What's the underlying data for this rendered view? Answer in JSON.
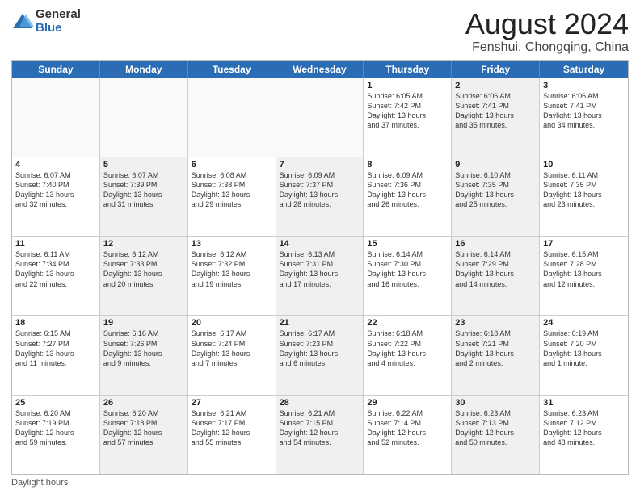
{
  "logo": {
    "general": "General",
    "blue": "Blue"
  },
  "title": "August 2024",
  "subtitle": "Fenshui, Chongqing, China",
  "days_of_week": [
    "Sunday",
    "Monday",
    "Tuesday",
    "Wednesday",
    "Thursday",
    "Friday",
    "Saturday"
  ],
  "weeks": [
    [
      {
        "day": "",
        "info": "",
        "empty": true
      },
      {
        "day": "",
        "info": "",
        "empty": true
      },
      {
        "day": "",
        "info": "",
        "empty": true
      },
      {
        "day": "",
        "info": "",
        "empty": true
      },
      {
        "day": "1",
        "info": "Sunrise: 6:05 AM\nSunset: 7:42 PM\nDaylight: 13 hours\nand 37 minutes."
      },
      {
        "day": "2",
        "info": "Sunrise: 6:06 AM\nSunset: 7:41 PM\nDaylight: 13 hours\nand 35 minutes.",
        "shaded": true
      },
      {
        "day": "3",
        "info": "Sunrise: 6:06 AM\nSunset: 7:41 PM\nDaylight: 13 hours\nand 34 minutes."
      }
    ],
    [
      {
        "day": "4",
        "info": "Sunrise: 6:07 AM\nSunset: 7:40 PM\nDaylight: 13 hours\nand 32 minutes."
      },
      {
        "day": "5",
        "info": "Sunrise: 6:07 AM\nSunset: 7:39 PM\nDaylight: 13 hours\nand 31 minutes.",
        "shaded": true
      },
      {
        "day": "6",
        "info": "Sunrise: 6:08 AM\nSunset: 7:38 PM\nDaylight: 13 hours\nand 29 minutes."
      },
      {
        "day": "7",
        "info": "Sunrise: 6:09 AM\nSunset: 7:37 PM\nDaylight: 13 hours\nand 28 minutes.",
        "shaded": true
      },
      {
        "day": "8",
        "info": "Sunrise: 6:09 AM\nSunset: 7:36 PM\nDaylight: 13 hours\nand 26 minutes."
      },
      {
        "day": "9",
        "info": "Sunrise: 6:10 AM\nSunset: 7:35 PM\nDaylight: 13 hours\nand 25 minutes.",
        "shaded": true
      },
      {
        "day": "10",
        "info": "Sunrise: 6:11 AM\nSunset: 7:35 PM\nDaylight: 13 hours\nand 23 minutes."
      }
    ],
    [
      {
        "day": "11",
        "info": "Sunrise: 6:11 AM\nSunset: 7:34 PM\nDaylight: 13 hours\nand 22 minutes."
      },
      {
        "day": "12",
        "info": "Sunrise: 6:12 AM\nSunset: 7:33 PM\nDaylight: 13 hours\nand 20 minutes.",
        "shaded": true
      },
      {
        "day": "13",
        "info": "Sunrise: 6:12 AM\nSunset: 7:32 PM\nDaylight: 13 hours\nand 19 minutes."
      },
      {
        "day": "14",
        "info": "Sunrise: 6:13 AM\nSunset: 7:31 PM\nDaylight: 13 hours\nand 17 minutes.",
        "shaded": true
      },
      {
        "day": "15",
        "info": "Sunrise: 6:14 AM\nSunset: 7:30 PM\nDaylight: 13 hours\nand 16 minutes."
      },
      {
        "day": "16",
        "info": "Sunrise: 6:14 AM\nSunset: 7:29 PM\nDaylight: 13 hours\nand 14 minutes.",
        "shaded": true
      },
      {
        "day": "17",
        "info": "Sunrise: 6:15 AM\nSunset: 7:28 PM\nDaylight: 13 hours\nand 12 minutes."
      }
    ],
    [
      {
        "day": "18",
        "info": "Sunrise: 6:15 AM\nSunset: 7:27 PM\nDaylight: 13 hours\nand 11 minutes."
      },
      {
        "day": "19",
        "info": "Sunrise: 6:16 AM\nSunset: 7:26 PM\nDaylight: 13 hours\nand 9 minutes.",
        "shaded": true
      },
      {
        "day": "20",
        "info": "Sunrise: 6:17 AM\nSunset: 7:24 PM\nDaylight: 13 hours\nand 7 minutes."
      },
      {
        "day": "21",
        "info": "Sunrise: 6:17 AM\nSunset: 7:23 PM\nDaylight: 13 hours\nand 6 minutes.",
        "shaded": true
      },
      {
        "day": "22",
        "info": "Sunrise: 6:18 AM\nSunset: 7:22 PM\nDaylight: 13 hours\nand 4 minutes."
      },
      {
        "day": "23",
        "info": "Sunrise: 6:18 AM\nSunset: 7:21 PM\nDaylight: 13 hours\nand 2 minutes.",
        "shaded": true
      },
      {
        "day": "24",
        "info": "Sunrise: 6:19 AM\nSunset: 7:20 PM\nDaylight: 13 hours\nand 1 minute."
      }
    ],
    [
      {
        "day": "25",
        "info": "Sunrise: 6:20 AM\nSunset: 7:19 PM\nDaylight: 12 hours\nand 59 minutes."
      },
      {
        "day": "26",
        "info": "Sunrise: 6:20 AM\nSunset: 7:18 PM\nDaylight: 12 hours\nand 57 minutes.",
        "shaded": true
      },
      {
        "day": "27",
        "info": "Sunrise: 6:21 AM\nSunset: 7:17 PM\nDaylight: 12 hours\nand 55 minutes."
      },
      {
        "day": "28",
        "info": "Sunrise: 6:21 AM\nSunset: 7:15 PM\nDaylight: 12 hours\nand 54 minutes.",
        "shaded": true
      },
      {
        "day": "29",
        "info": "Sunrise: 6:22 AM\nSunset: 7:14 PM\nDaylight: 12 hours\nand 52 minutes."
      },
      {
        "day": "30",
        "info": "Sunrise: 6:23 AM\nSunset: 7:13 PM\nDaylight: 12 hours\nand 50 minutes.",
        "shaded": true
      },
      {
        "day": "31",
        "info": "Sunrise: 6:23 AM\nSunset: 7:12 PM\nDaylight: 12 hours\nand 48 minutes."
      }
    ]
  ],
  "footer": "Daylight hours"
}
